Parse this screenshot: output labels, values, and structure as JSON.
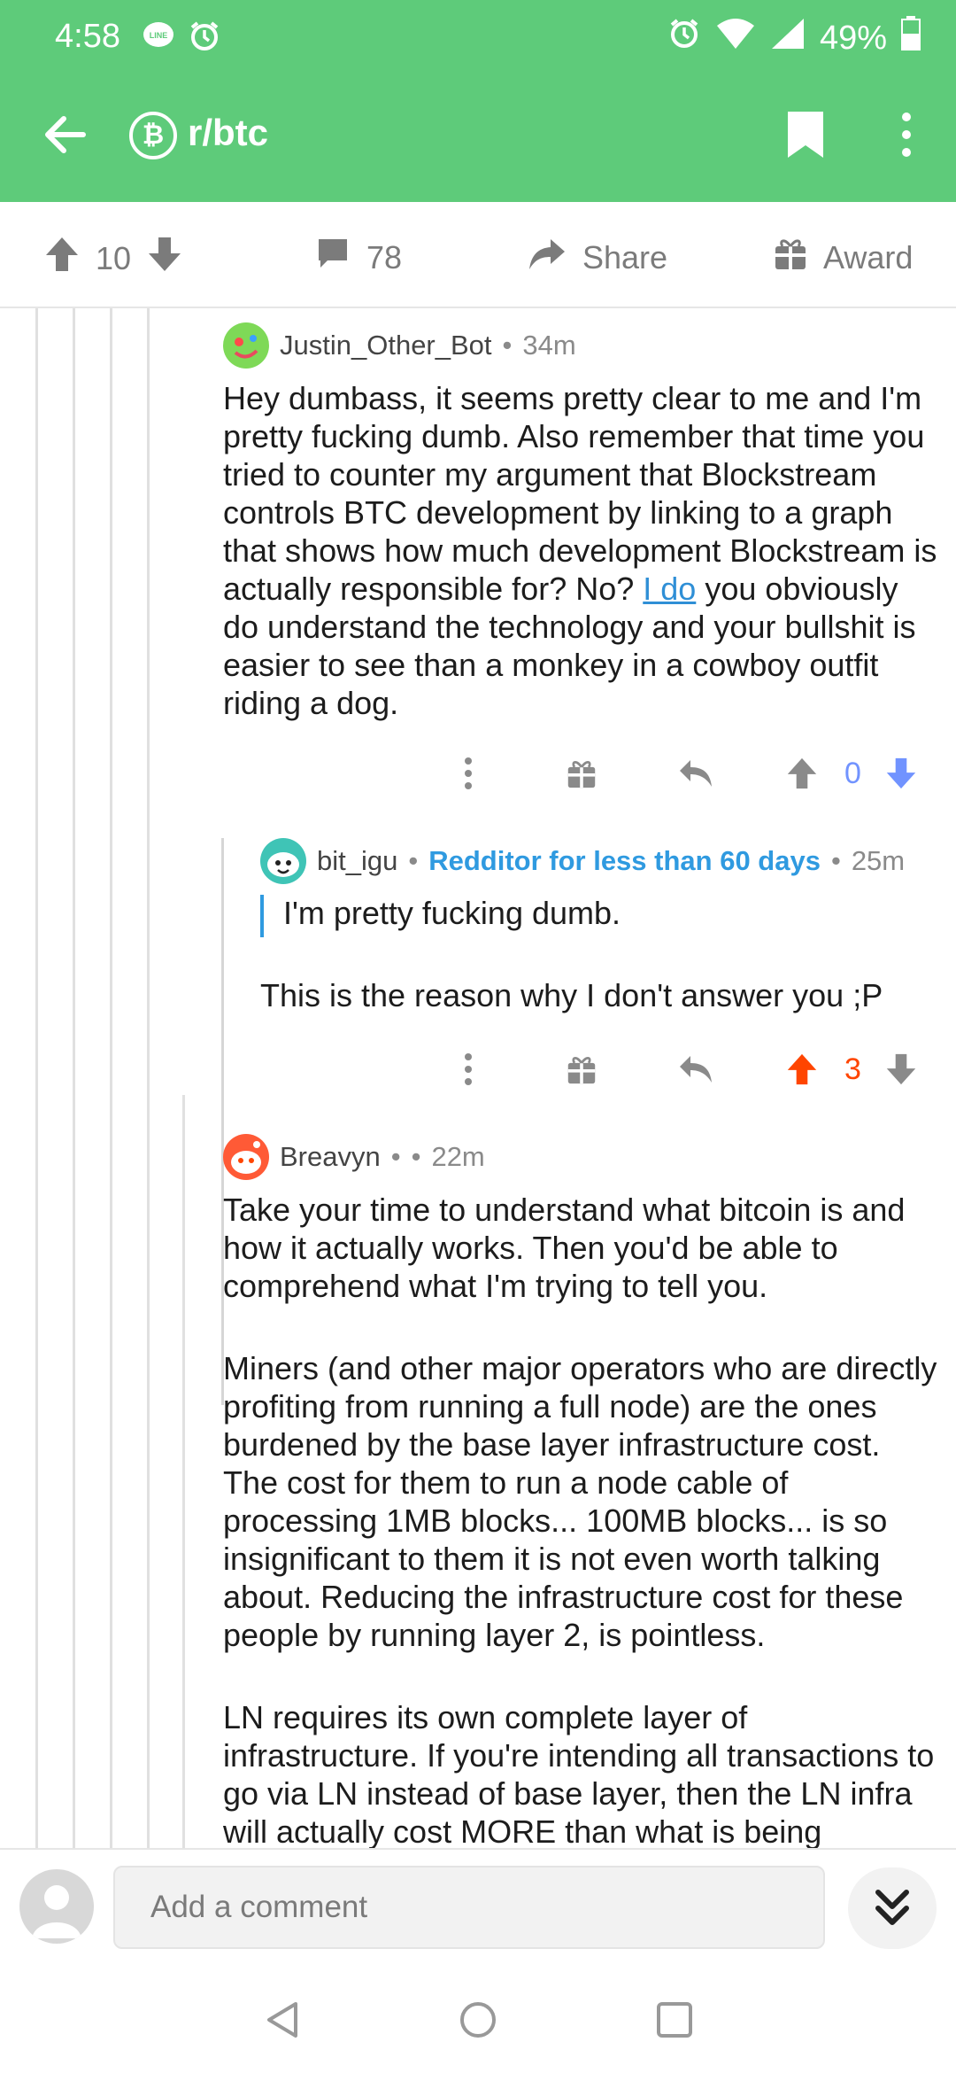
{
  "status_bar": {
    "time": "4:58",
    "battery": "49%",
    "left_icons": [
      "line-app-icon",
      "alarm-icon"
    ],
    "right_icons": [
      "alarm-icon",
      "wifi-icon",
      "signal-icon",
      "battery-icon"
    ]
  },
  "app_bar": {
    "title": "r/btc",
    "sub_icon_glyph": "₿",
    "color": "#5ecb7a"
  },
  "post_actions": {
    "score": "10",
    "comments": "78",
    "share_label": "Share",
    "award_label": "Award"
  },
  "comments": [
    {
      "author": "Justin_Other_Bot",
      "separator": "•",
      "age": "34m",
      "body_before_link": "Hey dumbass, it seems pretty clear to me and I'm pretty fucking dumb. Also remember that time you tried to counter my argument that Blockstream controls BTC development by linking to a graph that shows how much development Blockstream is actually responsible for? No? ",
      "link_text": "I do",
      "body_after_link": " you obviously do understand the technology and your bullshit is easier to see than a monkey in a cowboy outfit riding a dog.",
      "score": "0",
      "vote_state": "none"
    },
    {
      "author": "bit_igu",
      "separator": "•",
      "flair": "Redditor for less than 60 days",
      "separator2": "•",
      "age": "25m",
      "quote": "I'm pretty fucking dumb.",
      "body": "This is the reason why I don't answer you ;P",
      "score": "3",
      "vote_state": "upvoted"
    },
    {
      "author": "Breavyn",
      "separator": "•",
      "separator2": "•",
      "age": "22m",
      "paragraphs": [
        "Take your time to understand what bitcoin is and how it actually works. Then you'd be able to comprehend what I'm trying to tell you.",
        "Miners (and other major operators who are directly profiting from running a full node) are the ones burdened by the base layer infrastructure cost. The cost for them to run a node cable of processing 1MB blocks... 100MB blocks... is so insignificant to them it is not even worth talking about. Reducing the infrastructure cost for these people by running layer 2, is pointless.",
        "LN requires its own complete layer of infrastructure. If you're intending all transactions to go via LN instead of base layer, then the LN infra will actually cost MORE than what is being"
      ]
    }
  ],
  "composer": {
    "placeholder": "Add a comment"
  },
  "colors": {
    "upvote": "#ff4500",
    "downvote": "#7193ff",
    "accent": "#2f9ae0"
  }
}
